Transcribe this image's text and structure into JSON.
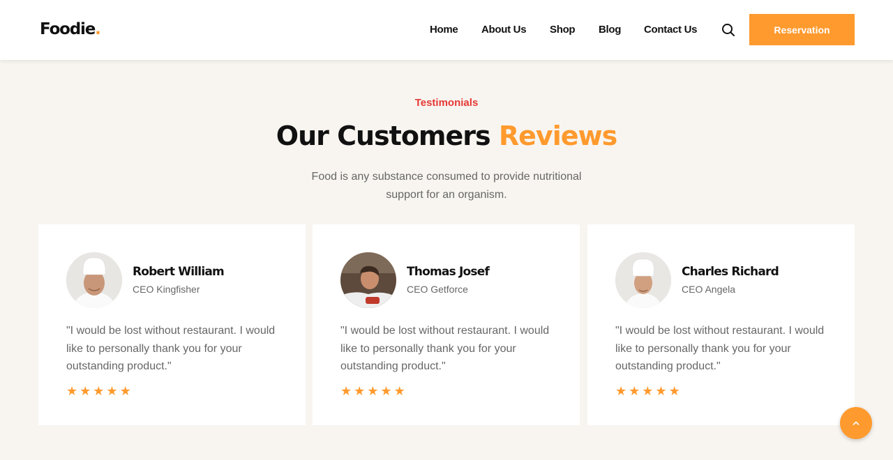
{
  "brand": {
    "name": "Foodie",
    "dot": "."
  },
  "nav": {
    "items": [
      {
        "label": "Home"
      },
      {
        "label": "About Us"
      },
      {
        "label": "Shop"
      },
      {
        "label": "Blog"
      },
      {
        "label": "Contact Us"
      }
    ],
    "search_icon": "search-icon",
    "reservation_label": "Reservation"
  },
  "section": {
    "eyebrow": "Testimonials",
    "title_main": "Our Customers",
    "title_highlight": "Reviews",
    "subtitle": "Food is any substance consumed to provide nutritional support for an organism."
  },
  "testimonials": [
    {
      "name": "Robert William",
      "role": "CEO Kingfisher",
      "quote": "\"I would be lost without restaurant. I would like to personally thank you for your outstanding product.\"",
      "rating": 5
    },
    {
      "name": "Thomas Josef",
      "role": "CEO Getforce",
      "quote": "\"I would be lost without restaurant. I would like to personally thank you for your outstanding product.\"",
      "rating": 5
    },
    {
      "name": "Charles Richard",
      "role": "CEO Angela",
      "quote": "\"I would be lost without restaurant. I would like to personally thank you for your outstanding product.\"",
      "rating": 5
    }
  ],
  "colors": {
    "accent": "#ff9a2e",
    "eyebrow": "#e53935",
    "background": "#f8f5f0"
  },
  "scroll_top_icon": "chevron-up-icon"
}
